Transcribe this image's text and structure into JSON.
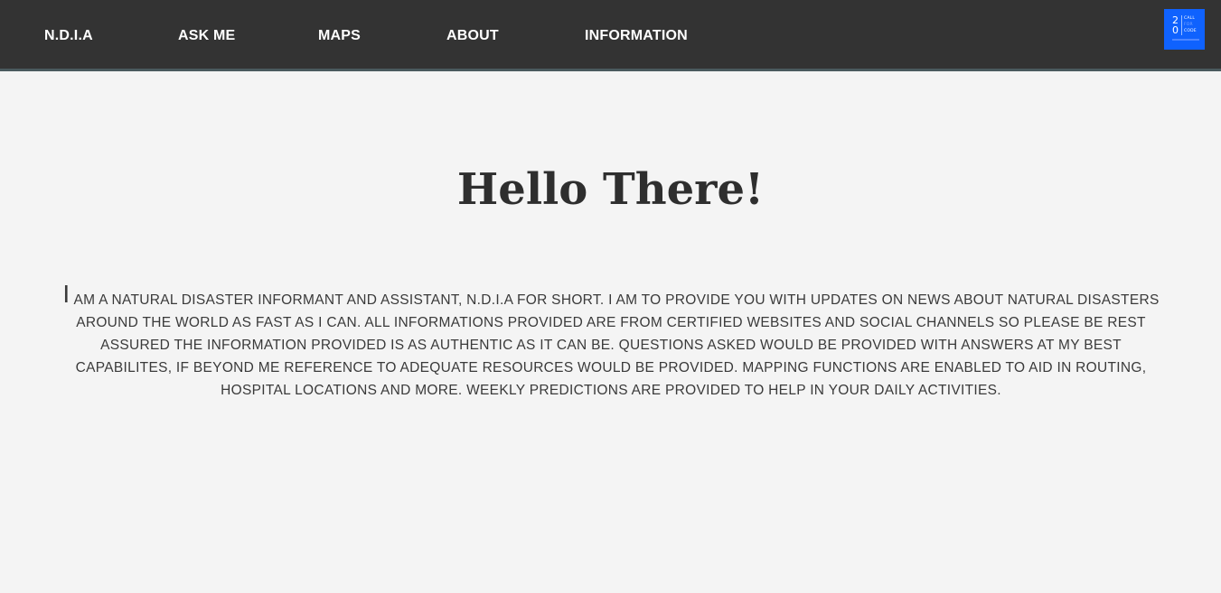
{
  "nav": {
    "items": [
      {
        "label": "N.D.I.A"
      },
      {
        "label": "ASK ME"
      },
      {
        "label": "MAPS"
      },
      {
        "label": "ABOUT"
      },
      {
        "label": "INFORMATION"
      }
    ],
    "logo": {
      "digits_top": "2",
      "digits_bottom": "0",
      "word1": "CALL",
      "word2": "FOR",
      "word3": "CODE",
      "background_color": "#0f62fe"
    },
    "background_color": "#333333"
  },
  "main": {
    "title": "Hello There!",
    "intro_first_letter": "I",
    "intro_text": "am a natural disaster informant and assistant, N.D.I.A for short. I am to provide you with updates on news about natural disasters around the world as fast as I can. All informations provided are from certified websites and social channels so please be rest assured the information provided is as authentic as it can be. Questions asked would be provided with answers at my best capabilites, if beyond me reference to adequate resources would be provided. Mapping functions are enabled to aid in routing, hospital locations and more. Weekly predictions are provided to help in your daily activities."
  }
}
